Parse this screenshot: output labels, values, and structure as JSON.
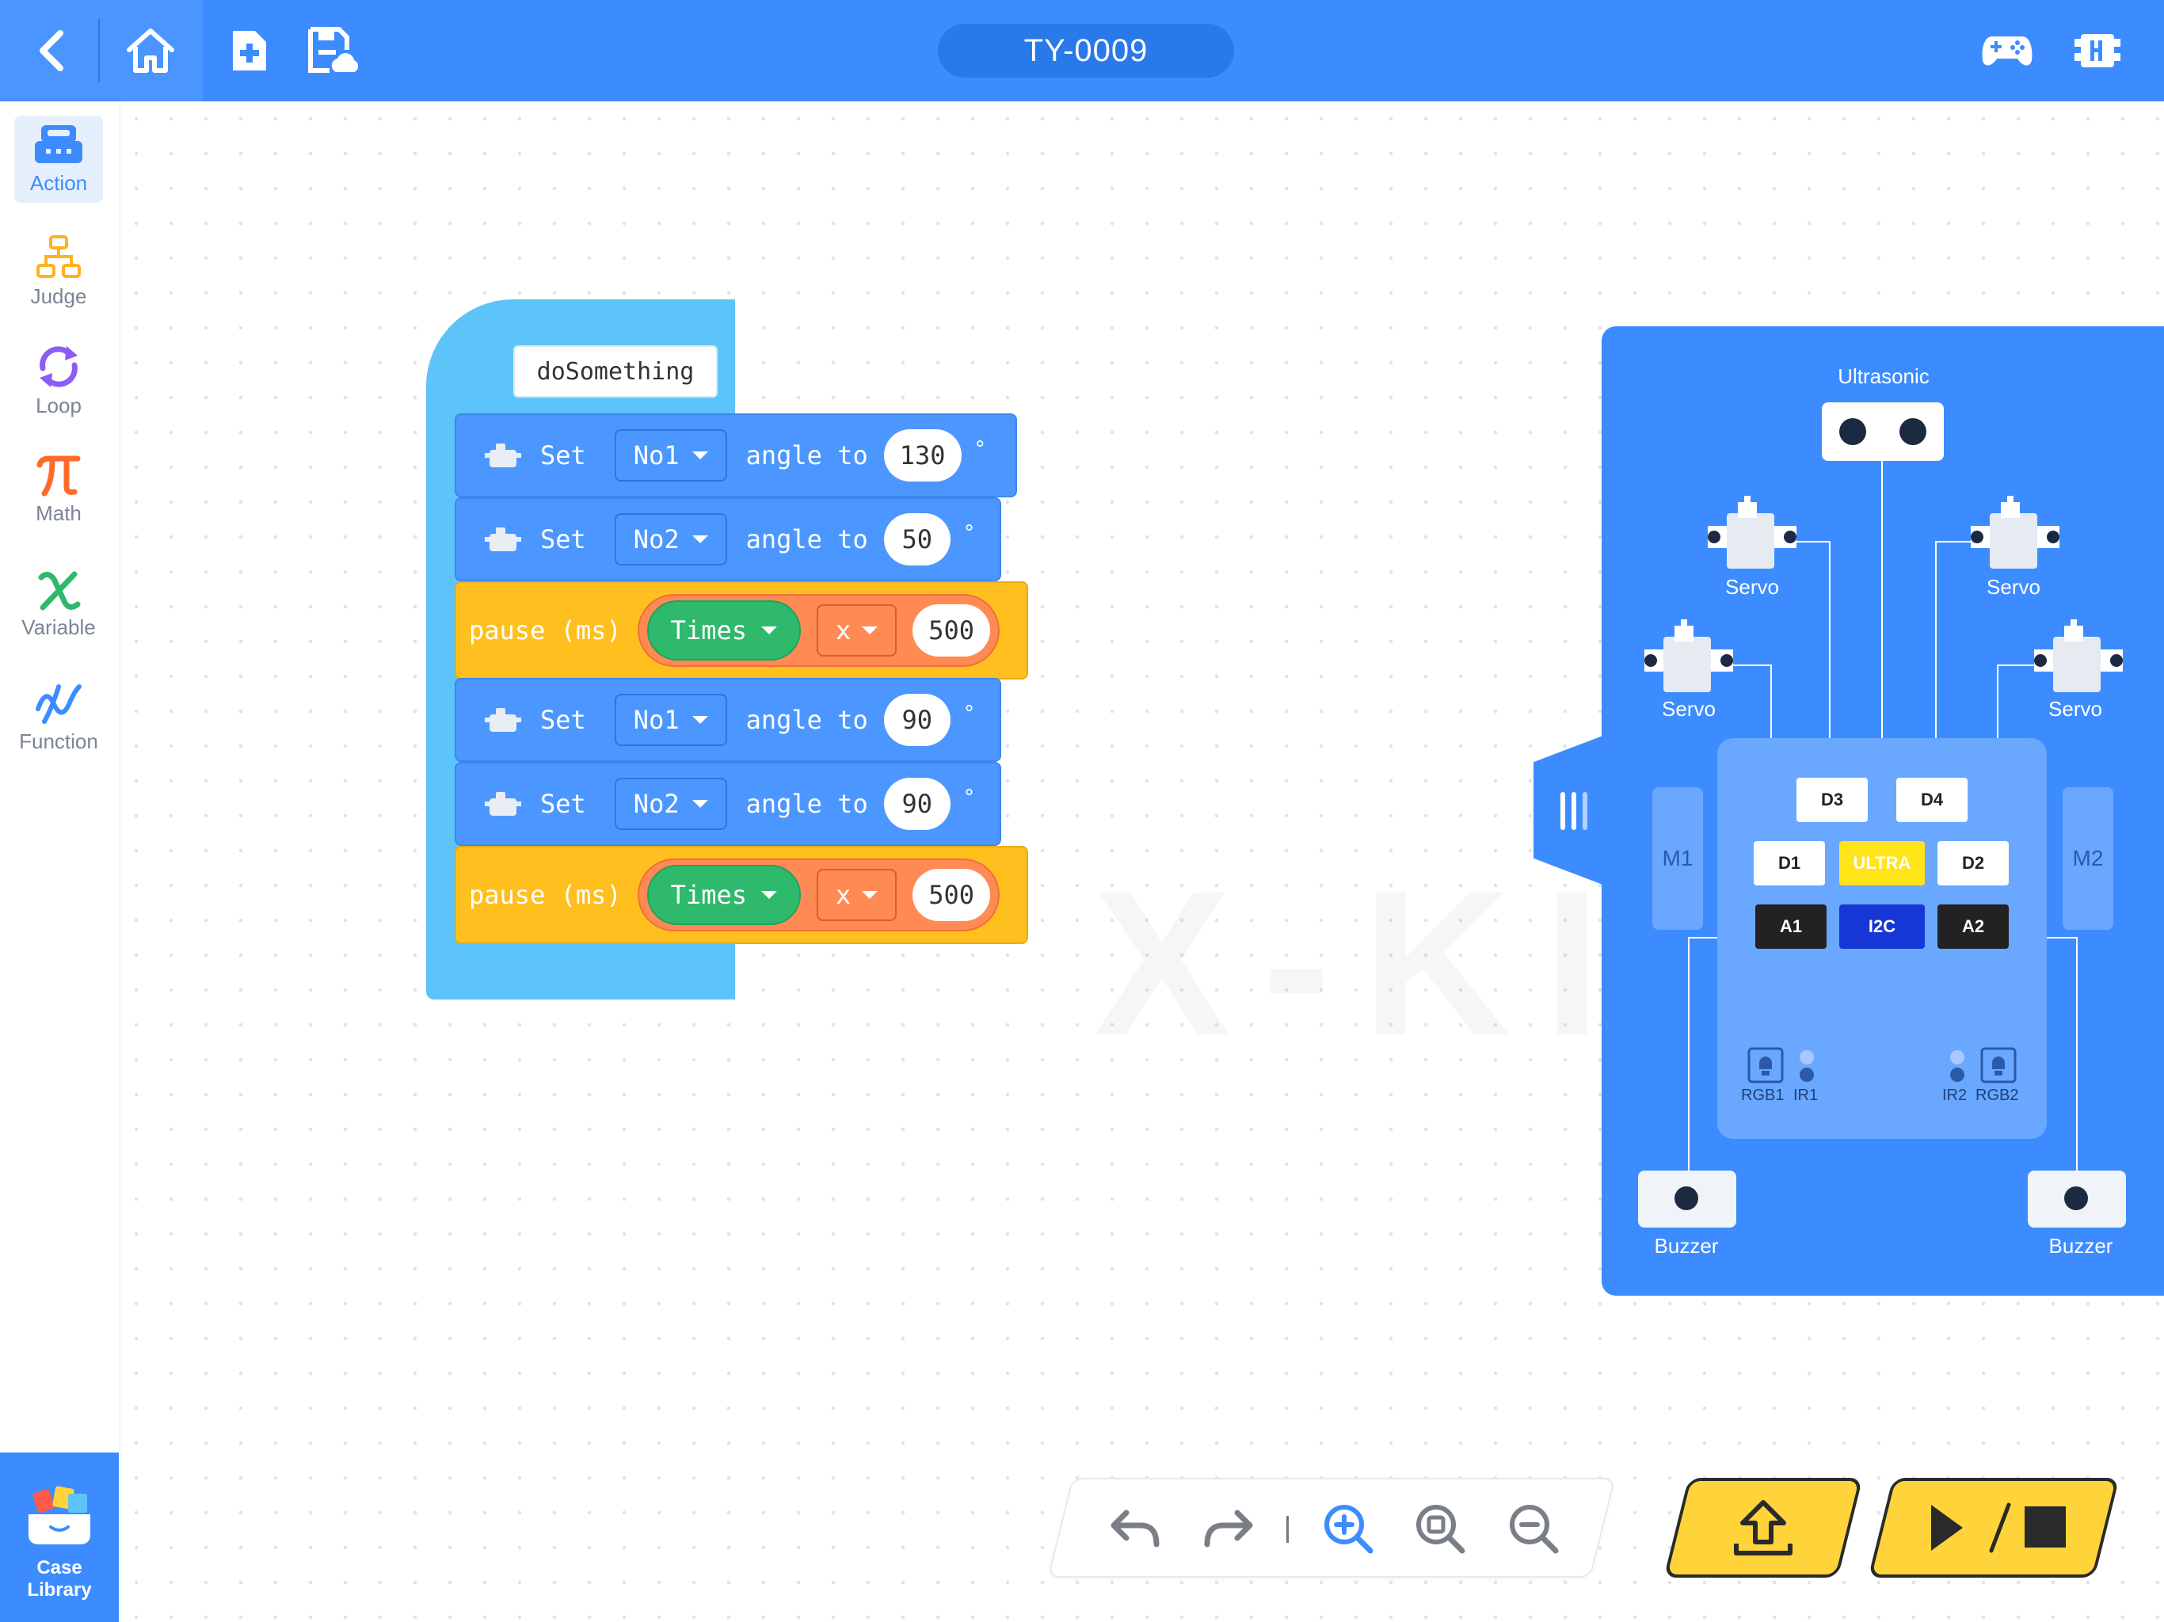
{
  "header": {
    "title": "TY-0009"
  },
  "sidebar": {
    "items": [
      {
        "label": "Action"
      },
      {
        "label": "Judge"
      },
      {
        "label": "Loop"
      },
      {
        "label": "Math"
      },
      {
        "label": "Variable"
      },
      {
        "label": "Function"
      }
    ],
    "case_library": "Case Library"
  },
  "canvas": {
    "watermark": "X-KIT"
  },
  "blocks": {
    "function_name": "doSomething",
    "set_kw": "Set",
    "angle_kw": "angle to",
    "degree_symbol": "°",
    "pause_kw": "pause (ms)",
    "times_label": "Times",
    "op_label": "x",
    "rows": [
      {
        "type": "servo",
        "servo": "No1",
        "angle": "130"
      },
      {
        "type": "servo",
        "servo": "No2",
        "angle": "50"
      },
      {
        "type": "pause",
        "value": "500"
      },
      {
        "type": "servo",
        "servo": "No1",
        "angle": "90"
      },
      {
        "type": "servo",
        "servo": "No2",
        "angle": "90"
      },
      {
        "type": "pause",
        "value": "500"
      }
    ]
  },
  "device": {
    "ultrasonic": "Ultrasonic",
    "servo": "Servo",
    "buzzer": "Buzzer",
    "motors": {
      "left": "M1",
      "right": "M2"
    },
    "ports": {
      "d3": "D3",
      "d4": "D4",
      "d1": "D1",
      "ultra": "ULTRA",
      "d2": "D2",
      "a1": "A1",
      "i2c": "I2C",
      "a2": "A2"
    },
    "sensors": {
      "rgb1": "RGB1",
      "ir1": "IR1",
      "ir2": "IR2",
      "rgb2": "RGB2"
    }
  },
  "colors": {
    "brand_blue": "#3d8cff",
    "servo_block": "#4c97ff",
    "pause_block": "#ffbf1f",
    "function_block": "#5cc4f8",
    "times_green": "#2eb96d",
    "math_orange": "#ff8a54",
    "action_yellow": "#ffd43a"
  }
}
